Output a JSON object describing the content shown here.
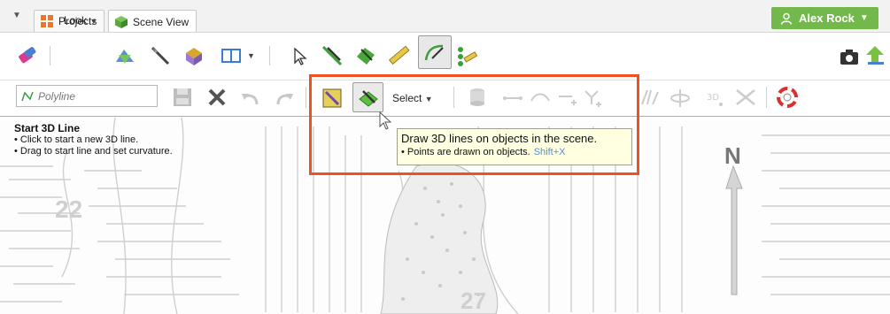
{
  "tabs": {
    "menu_icon": "dropdown-triangle-icon",
    "items": [
      {
        "label": "Projects",
        "icon": "grid-icon",
        "active": false
      },
      {
        "label": "Scene View",
        "icon": "cube-icon",
        "active": true
      }
    ]
  },
  "user": {
    "name": "Alex Rock",
    "icon": "person-icon",
    "color": "#73b84b"
  },
  "toolbar": {
    "look_label": "Look",
    "row1_icons": [
      "eraser-icon",
      "look-icon",
      "axis-slicer-icon",
      "slice-icon",
      "box-icon",
      "layout-icon",
      "arrow-select-icon",
      "draw-line-icon",
      "draw-on-object-icon",
      "ruler-icon",
      "polyline-edit-icon",
      "multi-line-icon",
      "camera-icon",
      "upload-icon"
    ]
  },
  "edit_bar": {
    "polyline_placeholder": "Polyline",
    "select_label": "Select",
    "icons": [
      "save-icon",
      "delete-icon",
      "undo-icon",
      "redo-icon",
      "draw-on-slice-icon",
      "draw-on-objects-icon",
      "cylinder-icon",
      "straight-segment-icon",
      "curved-segment-icon",
      "add-point-icon",
      "insert-point-icon",
      "split-icon",
      "orbit-icon",
      "3d-points-icon",
      "clip-icon",
      "help-lifebuoy-icon"
    ]
  },
  "hint": {
    "title": "Start 3D Line",
    "lines": [
      "• Click to start a new 3D line.",
      "• Drag to start line and set curvature."
    ]
  },
  "tooltip": {
    "main": "Draw 3D lines on objects in the scene.",
    "sub": "• Points are drawn on objects.",
    "shortcut": "Shift+X"
  },
  "map_labels": {
    "left_number": "22",
    "bottom_number": "27",
    "north": "N"
  },
  "colors": {
    "highlight": "#f25022",
    "tooltip_bg": "#ffffe1",
    "accent_orange": "#f0a030"
  }
}
